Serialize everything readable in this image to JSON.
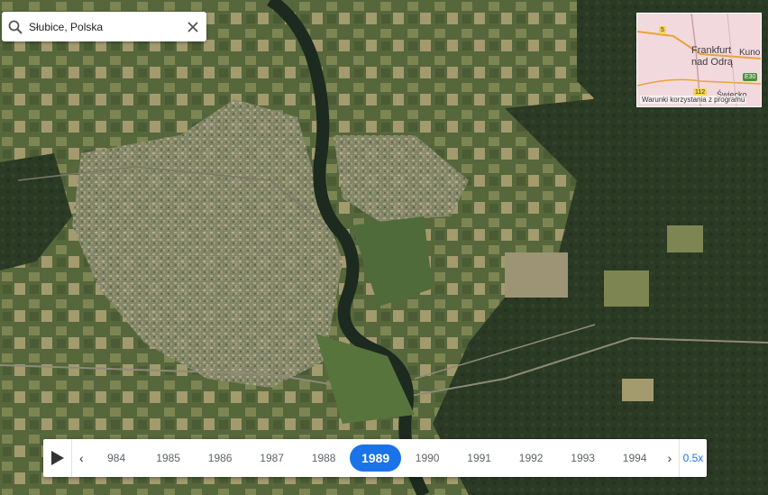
{
  "search": {
    "value": "Słubice, Polska"
  },
  "minimap": {
    "city_label_line1": "Frankfurt",
    "city_label_line2": "nad Odrą",
    "kunersdorf_label": "Kuno",
    "road_5": "5",
    "road_e30": "E30",
    "road_112": "112",
    "oslo_label": "Świecko",
    "terms": "Warunki korzystania z programu"
  },
  "timeline": {
    "years": [
      "984",
      "1985",
      "1986",
      "1987",
      "1988",
      "1989",
      "1990",
      "1991",
      "1992",
      "1993",
      "1994"
    ],
    "active_year": "1989",
    "speed": "0.5x"
  },
  "colors": {
    "accent": "#1a73e8"
  }
}
